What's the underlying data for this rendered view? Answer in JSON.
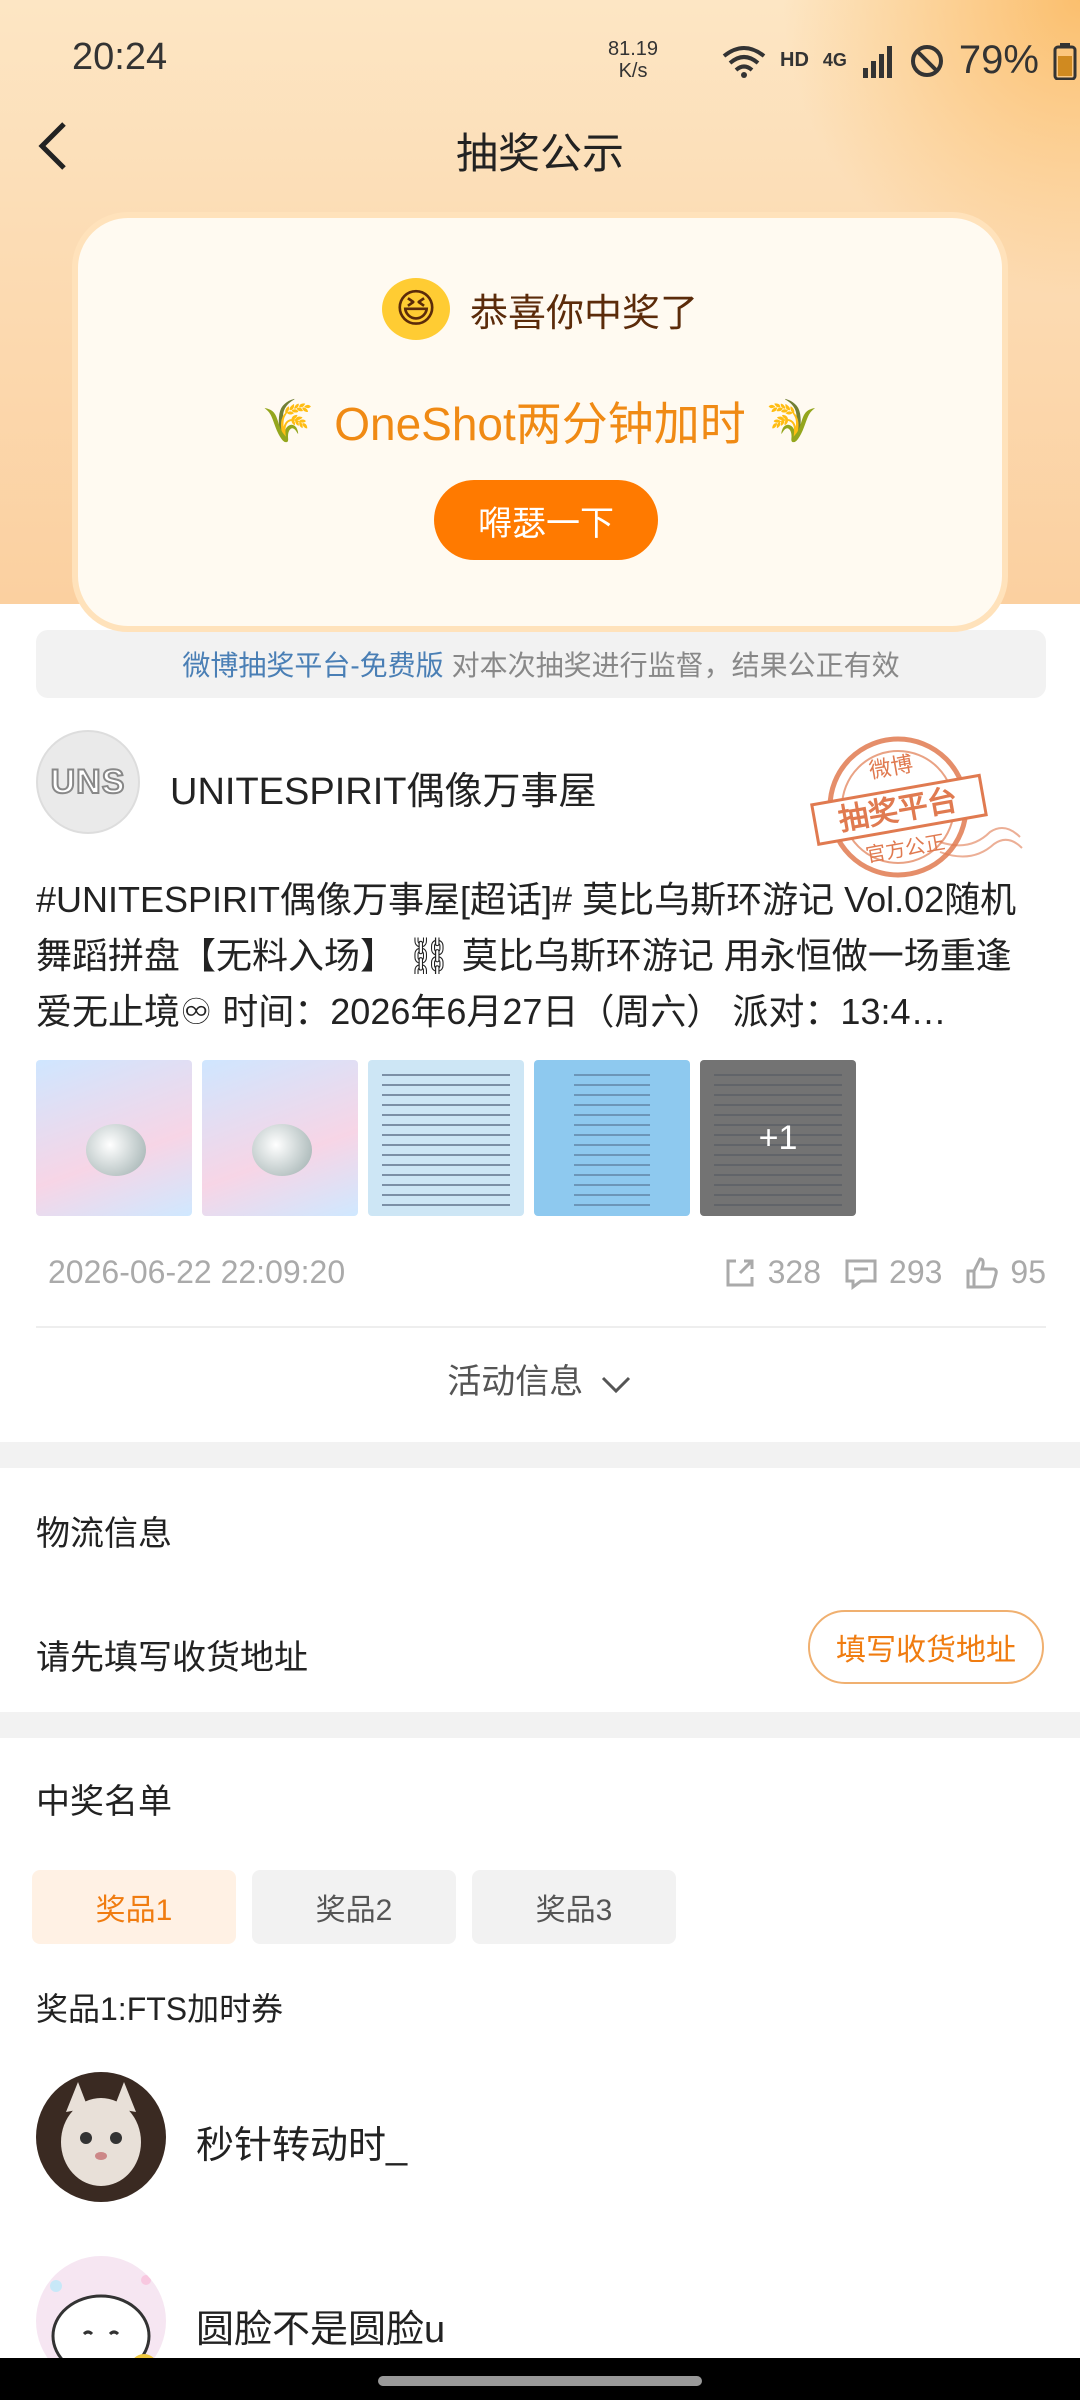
{
  "status_bar": {
    "time": "20:24",
    "speed_value": "81.19",
    "speed_unit": "K/s",
    "hd_label": "HD",
    "network_label": "4G",
    "battery": "79%"
  },
  "header": {
    "back_icon": "chevron-left-icon",
    "title": "抽奖公示"
  },
  "result_card": {
    "congrats_text": "恭喜你中奖了",
    "prize_name": "OneShot两分钟加时",
    "action_label": "嘚瑟一下"
  },
  "platform_notice": {
    "link_text": "微博抽奖平台-免费版",
    "text": "对本次抽奖进行监督，结果公正有效"
  },
  "account": {
    "avatar_text": "UNS",
    "name": "UNITESPIRIT偶像万事屋"
  },
  "stamp": {
    "line1": "微博",
    "line2": "抽奖平台",
    "line3": "官方公正"
  },
  "post": {
    "text": "#UNITESPIRIT偶像万事屋[超话]# 莫比乌斯环游记 Vol.02随机舞蹈拼盘【无料入场】 ⛓ 莫比乌斯环游记 用永恒做一场重逢 爱无止境♾ 时间：2026年6月27日（周六） 派对：13:4…",
    "more_images": "+1",
    "timestamp": "2026-06-22 22:09:20",
    "shares": "328",
    "comments": "293",
    "likes": "95"
  },
  "activity_info_label": "活动信息",
  "logistics": {
    "title": "物流信息",
    "prompt": "请先填写收货地址",
    "button_label": "填写收货地址"
  },
  "winners": {
    "title": "中奖名单",
    "tabs": [
      {
        "label": "奖品1"
      },
      {
        "label": "奖品2"
      },
      {
        "label": "奖品3"
      }
    ],
    "prize_label": "奖品1:FTS加时券",
    "list": [
      {
        "name": "秒针转动时_"
      },
      {
        "name": "圆脸不是圆脸u"
      }
    ]
  },
  "colors": {
    "accent": "#ff7a00",
    "link": "#4a7fb5",
    "stamp": "#e07a50"
  }
}
